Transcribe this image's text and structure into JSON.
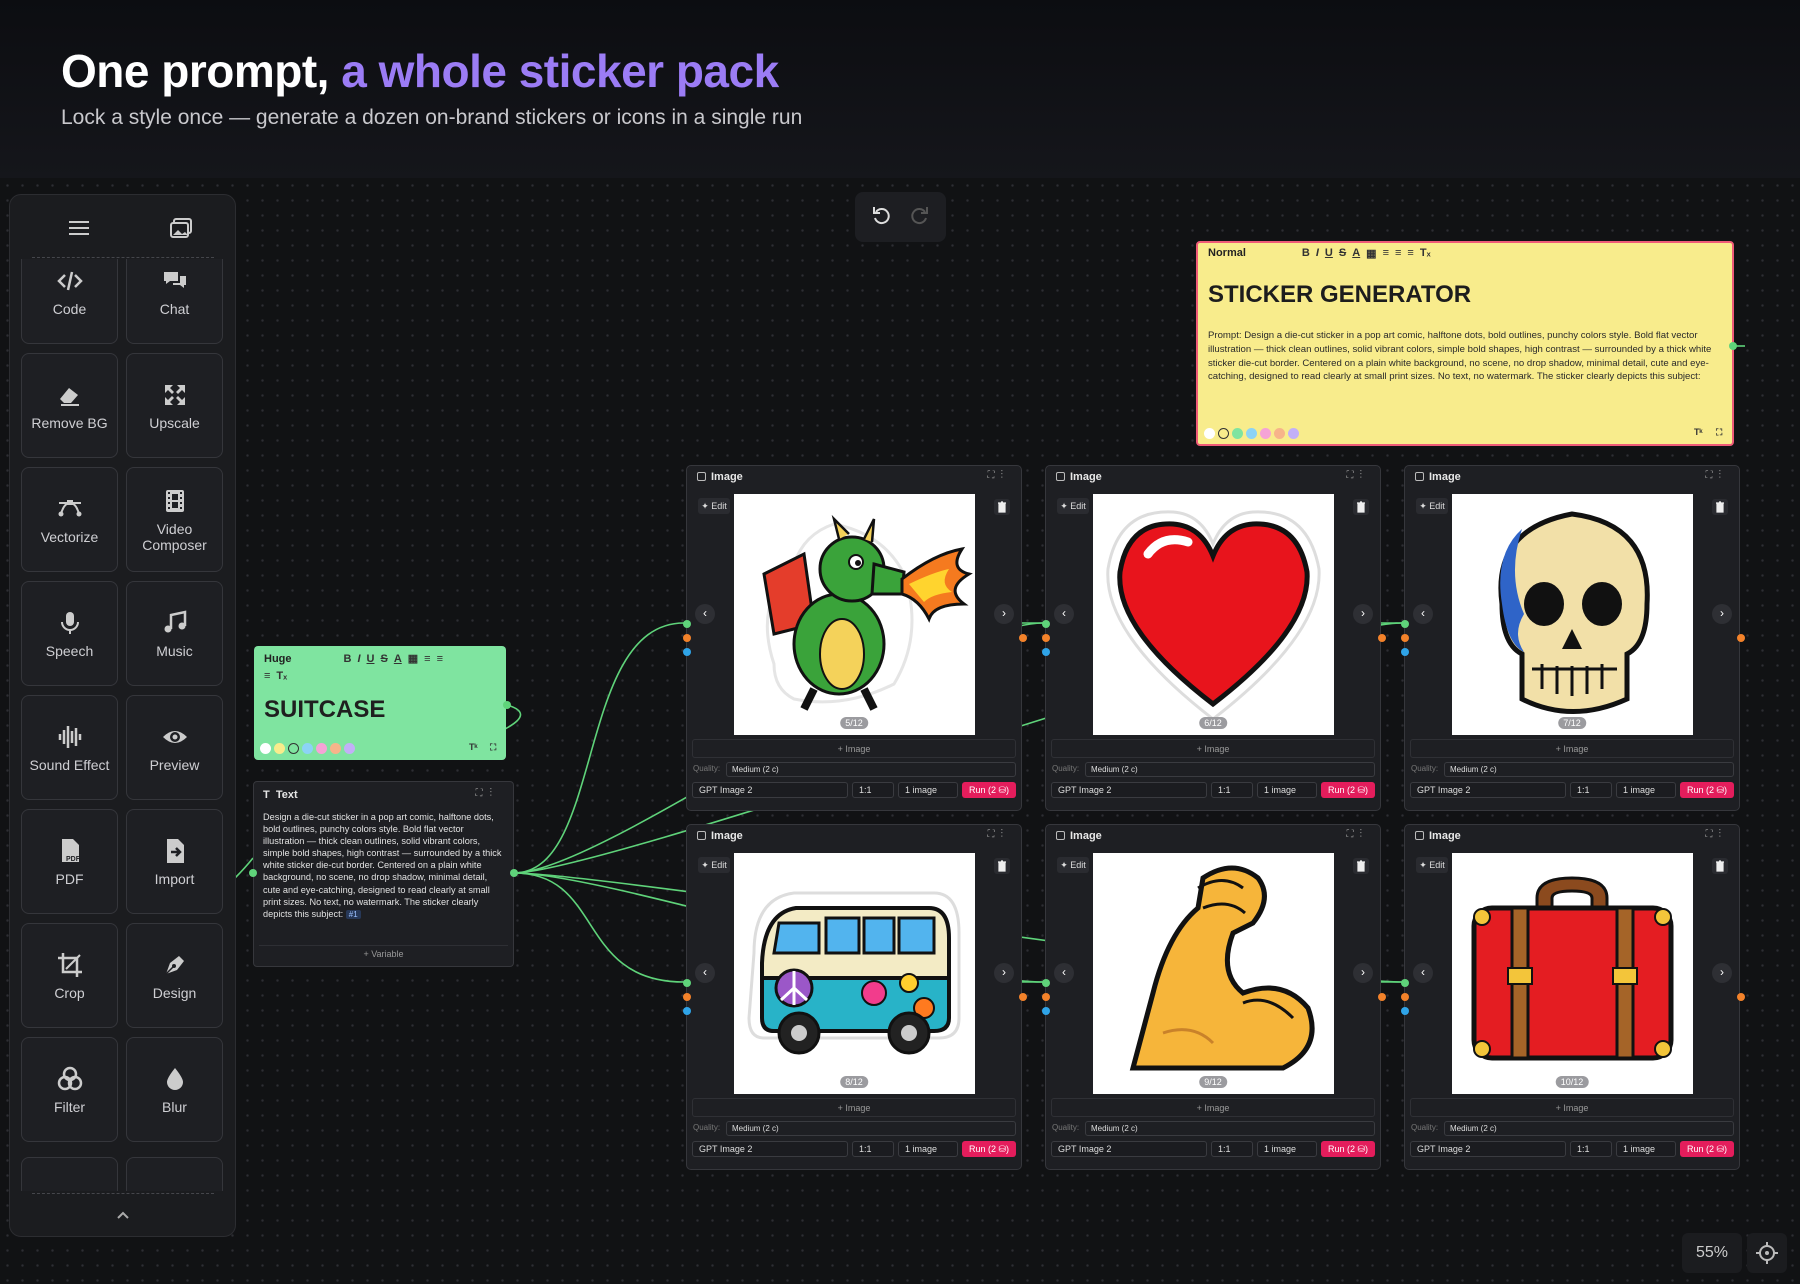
{
  "hero": {
    "title_plain": "One prompt, ",
    "title_accent": "a whole sticker pack",
    "subtitle": "Lock a style once — generate a dozen on-brand stickers or icons in a single run",
    "accent_color": "#9b7cf5"
  },
  "sidebar": {
    "top_icons": [
      "menu-icon",
      "gallery-icon"
    ],
    "tools": [
      {
        "label": "Code",
        "icon": "code-icon"
      },
      {
        "label": "Chat",
        "icon": "chat-icon"
      },
      {
        "label": "Remove BG",
        "icon": "eraser-icon"
      },
      {
        "label": "Upscale",
        "icon": "upscale-icon"
      },
      {
        "label": "Vectorize",
        "icon": "vector-icon"
      },
      {
        "label": "Video Composer",
        "icon": "film-icon"
      },
      {
        "label": "Speech",
        "icon": "microphone-icon"
      },
      {
        "label": "Music",
        "icon": "music-note-icon"
      },
      {
        "label": "Sound Effect",
        "icon": "waveform-icon"
      },
      {
        "label": "Preview",
        "icon": "eye-icon"
      },
      {
        "label": "PDF",
        "icon": "pdf-file-icon"
      },
      {
        "label": "Import",
        "icon": "import-file-icon"
      },
      {
        "label": "Crop",
        "icon": "crop-icon"
      },
      {
        "label": "Design",
        "icon": "pen-nib-icon"
      },
      {
        "label": "Filter",
        "icon": "filter-circles-icon"
      },
      {
        "label": "Blur",
        "icon": "droplet-icon"
      }
    ]
  },
  "note_yellow": {
    "style": "Normal",
    "title": "STICKER GENERATOR",
    "body": "Prompt: Design a die-cut sticker in a pop art comic, halftone dots, bold outlines, punchy colors style. Bold flat vector illustration — thick clean outlines, solid vibrant colors, simple bold shapes, high contrast — surrounded by a thick white sticker die-cut border. Centered on a plain white background, no scene, no drop shadow, minimal detail, cute and eye-catching, designed to read clearly at small print sizes. No text, no watermark. The sticker clearly depicts this subject:",
    "fill": "#f8ec8c"
  },
  "note_green": {
    "style": "Huge",
    "title": "SUITCASE",
    "fill": "#7fe4a0"
  },
  "text_node": {
    "header": "Text",
    "body": "Design a die-cut sticker in a pop art comic, halftone dots, bold outlines, punchy colors style. Bold flat vector illustration — thick clean outlines, solid vibrant colors, simple bold shapes, high contrast — surrounded by a thick white sticker die-cut border. Centered on a plain white background, no scene, no drop shadow, minimal detail, cute and eye-catching, designed to read clearly at small print sizes. No text, no watermark. The sticker clearly depicts this subject:",
    "chip": "#1",
    "add_label": "+ Variable"
  },
  "image_nodes": [
    {
      "title": "Image",
      "counter": "5/12",
      "subject": "dragon"
    },
    {
      "title": "Image",
      "counter": "6/12",
      "subject": "heart"
    },
    {
      "title": "Image",
      "counter": "7/12",
      "subject": "skull"
    },
    {
      "title": "Image",
      "counter": "8/12",
      "subject": "van"
    },
    {
      "title": "Image",
      "counter": "9/12",
      "subject": "bicep"
    },
    {
      "title": "Image",
      "counter": "10/12",
      "subject": "suitcase"
    }
  ],
  "node_common": {
    "edit_label": "Edit",
    "add_image_label": "+ Image",
    "quality_label": "Quality:",
    "quality_value": "Medium (2 c)",
    "model": "GPT Image 2",
    "ratio": "1:1",
    "count": "1 image",
    "run_label": "Run (2 ⛁)",
    "run_color": "#e41d5c"
  },
  "wire_color": "#5fd37a",
  "zoom": "55%"
}
